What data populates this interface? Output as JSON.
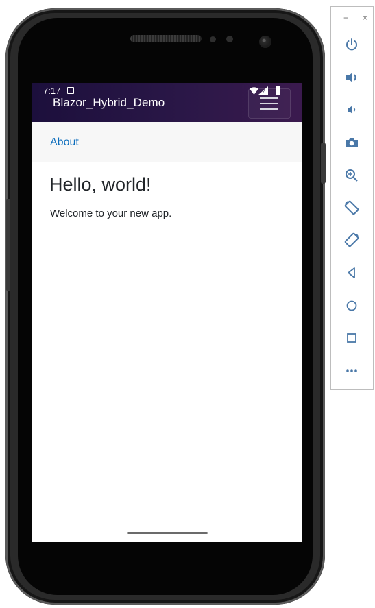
{
  "status_bar": {
    "time": "7:17"
  },
  "app": {
    "title": "Blazor_Hybrid_Demo",
    "top_nav": {
      "about_link": "About"
    },
    "content": {
      "heading": "Hello, world!",
      "text": "Welcome to your new app."
    }
  },
  "emulator_toolbar": {
    "window_controls": [
      "−",
      "×"
    ],
    "buttons": [
      {
        "icon": "power-icon"
      },
      {
        "icon": "volume-up-icon"
      },
      {
        "icon": "volume-down-icon"
      },
      {
        "icon": "camera-icon"
      },
      {
        "icon": "zoom-icon"
      },
      {
        "icon": "rotate-left-icon"
      },
      {
        "icon": "rotate-right-icon"
      },
      {
        "icon": "back-icon"
      },
      {
        "icon": "home-icon"
      },
      {
        "icon": "overview-icon"
      },
      {
        "icon": "more-icon"
      }
    ]
  },
  "colors": {
    "app_bar_gradient": [
      "#1c0f3c",
      "#3b1a4e"
    ],
    "link": "#0d6ebd",
    "toolbar_icon": "#4a78a8"
  }
}
